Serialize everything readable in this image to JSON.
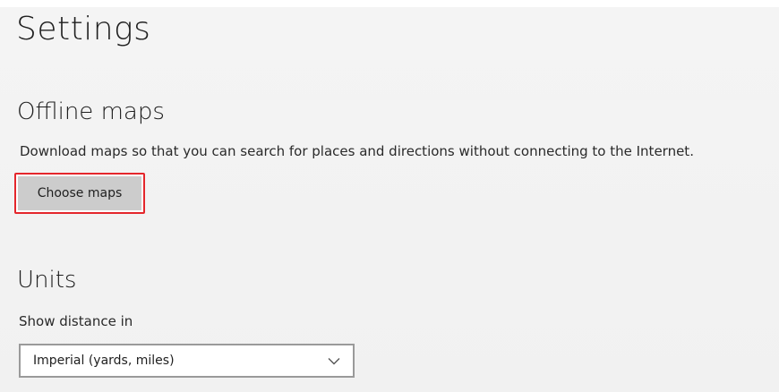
{
  "window": {
    "title": "Settings"
  },
  "offline_maps": {
    "heading": "Offline maps",
    "description": "Download maps so that you can search for places and directions without connecting to the Internet.",
    "button_label": "Choose maps",
    "button_highlight_color": "#e4262b"
  },
  "units": {
    "heading": "Units",
    "field_label": "Show distance in",
    "selected_value": "Imperial (yards, miles)",
    "dropdown_icon": "chevron-down-icon"
  },
  "colors": {
    "background": "#f3f3f3",
    "button_face": "#cccccc",
    "text": "#1f1f1f"
  }
}
